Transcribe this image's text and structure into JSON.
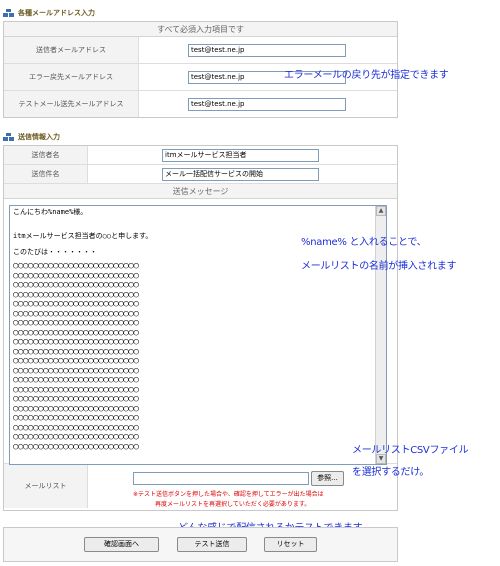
{
  "address_section": {
    "heading": "各種メールアドレス入力",
    "header": "すべて必須入力項目です",
    "rows": [
      {
        "label": "送信者メールアドレス",
        "value": "test@test.ne.jp"
      },
      {
        "label": "エラー戻先メールアドレス",
        "value": "test@test.ne.jp"
      },
      {
        "label": "テストメール送先メールアドレス",
        "value": "test@test.ne.jp"
      }
    ]
  },
  "notes": {
    "error_return": "エラーメールの戻り先が指定できます",
    "name_tag_line1": "%name% と入れることで、",
    "name_tag_line2": "メールリストの名前が挿入されます",
    "csv_line1": "メールリストCSVファイル",
    "csv_line2": "を選択するだけ。",
    "test_send": "どんな感じで配信されるかテストできます"
  },
  "send_section": {
    "heading": "送信情報入力",
    "sender_name_label": "送信者名",
    "sender_name_value": "itmメールサービス担当者",
    "subject_label": "送信件名",
    "subject_value": "メール一括配信サービスの開始",
    "message_label": "送信メッセージ",
    "message_line1": "こんにちわ%name%様。",
    "message_line2": "itmメールサービス担当者の○○と申します。",
    "message_line3": "このたびは・・・・・・・",
    "message_circle_row": "○○○○○○○○○○○○○○○○○○○○○○○○○",
    "mail_list_label": "メールリスト",
    "browse_label": "参照...",
    "warning_line1": "※テスト送信ボタンを押した場合や、確認を押してエラーが出た場合は",
    "warning_line2": "再度メールリストを再選択していただく必要があります。"
  },
  "buttons": {
    "confirm": "確認画面へ",
    "test_send": "テスト送信",
    "reset": "リセット"
  },
  "icons": {
    "section_icon": "stacked-boxes-icon",
    "scroll_up": "scroll-up-arrow-icon",
    "scroll_down": "scroll-down-arrow-icon"
  },
  "colors": {
    "note_text": "#1c2fd6",
    "warning_text": "#dd0000",
    "heading_text": "#6b5a1d",
    "section_icon": "#3b6fb0"
  }
}
